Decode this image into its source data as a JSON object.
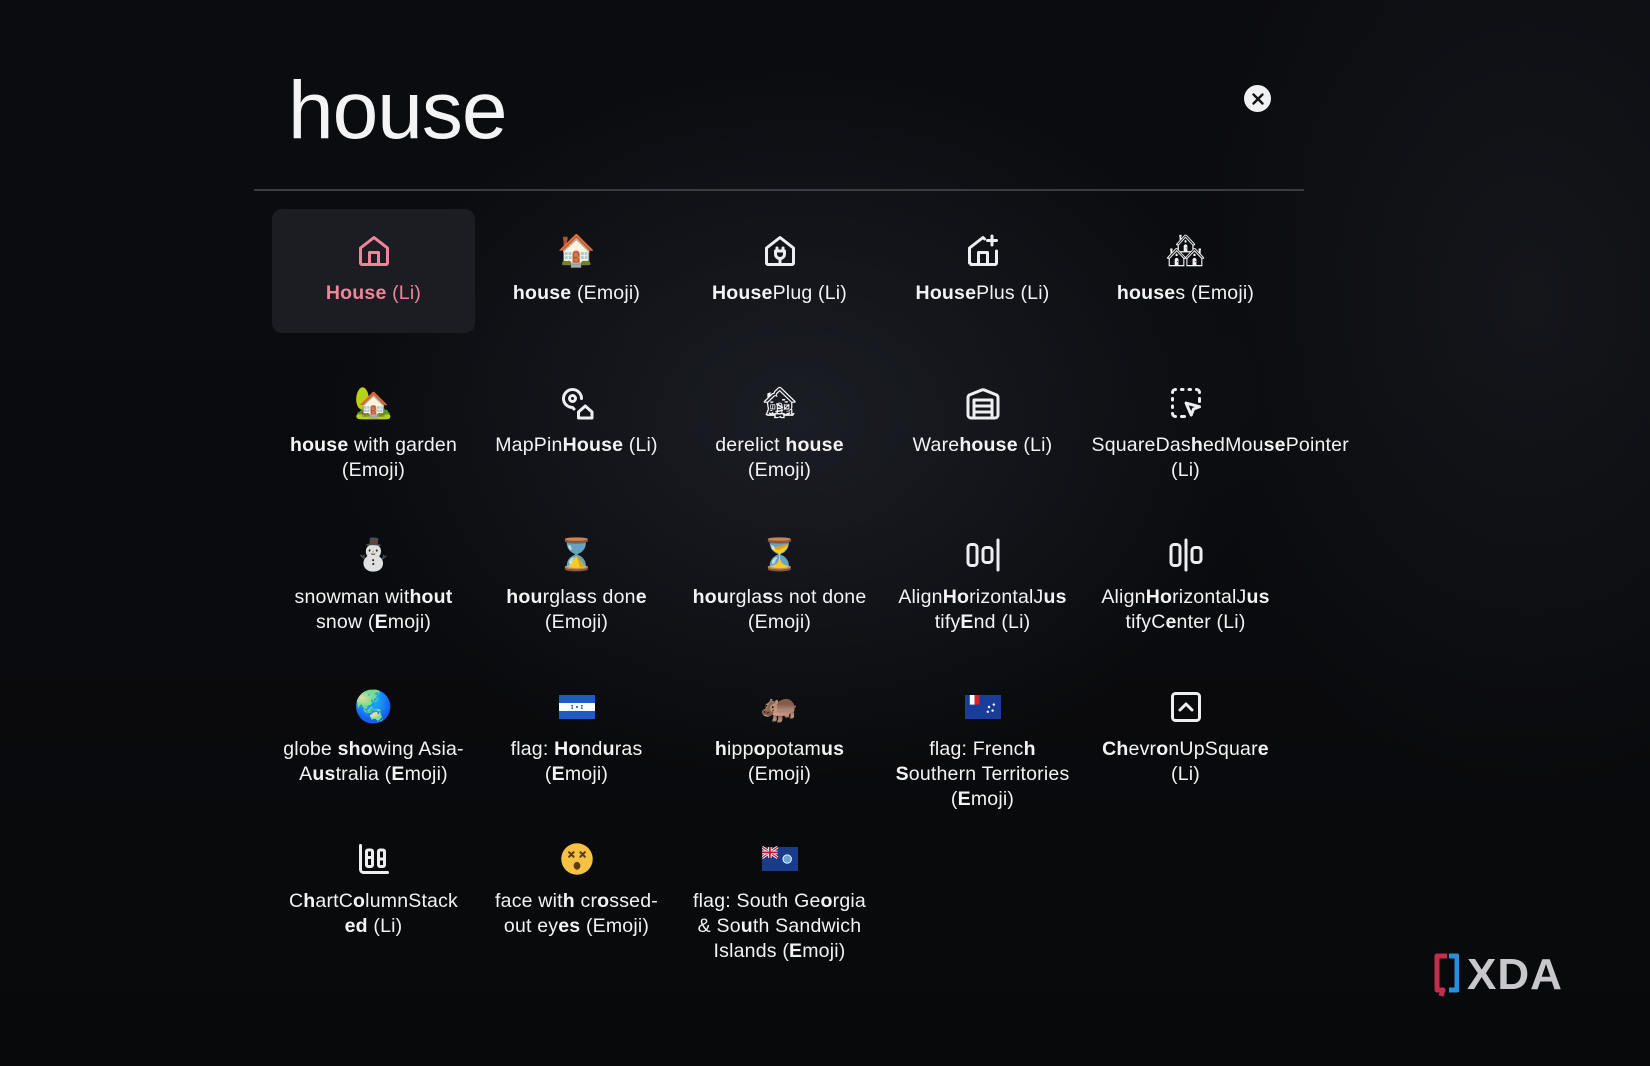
{
  "search": {
    "query": "house"
  },
  "results": [
    {
      "icon": "house-outline-icon",
      "pre": "",
      "bold": "House",
      "post": " (Li)",
      "selected": true
    },
    {
      "icon": "house-emoji",
      "pre": "",
      "bold": "house",
      "post": " (Emoji)"
    },
    {
      "icon": "house-plug-icon",
      "pre": "",
      "bold": "House",
      "post": "Plug (Li)"
    },
    {
      "icon": "house-plus-icon",
      "pre": "",
      "bold": "House",
      "post": "Plus (Li)"
    },
    {
      "icon": "houses-emoji",
      "pre": "",
      "bold": "house",
      "post": "s (Emoji)"
    },
    {
      "icon": "house-with-garden-emoji",
      "pre": "",
      "bold": "house",
      "post": " with garden (Emoji)"
    },
    {
      "icon": "map-pin-house-icon",
      "pre": "MapPin",
      "bold": "House",
      "post": " (Li)"
    },
    {
      "icon": "derelict-house-emoji",
      "pre": "derelict ",
      "bold": "house",
      "post": " (Emoji)"
    },
    {
      "icon": "warehouse-icon",
      "pre": "Ware",
      "bold": "house",
      "post": " (Li)"
    },
    {
      "icon": "square-dashed-mouse-pointer-icon",
      "pre": "SquareDas",
      "bold": "h",
      "post": "edMou",
      "bold2": "se",
      "post2": "Pointer (Li)"
    },
    {
      "icon": "snowman-emoji",
      "pre": "snowman wit",
      "bold": "hout",
      "post": " snow (",
      "bold2": "E",
      "post2": "moji)"
    },
    {
      "icon": "hourglass-done-emoji",
      "pre": "",
      "bold": "hou",
      "post": "rgla",
      "bold2": "s",
      "post2": "s don",
      "bold3": "e",
      "post3": " (Emoji)"
    },
    {
      "icon": "hourglass-not-done-emoji",
      "pre": "",
      "bold": "hou",
      "post": "rgla",
      "bold2": "s",
      "post2": "s not done (Emoji)"
    },
    {
      "icon": "align-horizontal-justify-end-icon",
      "pre": "Align",
      "bold": "Ho",
      "post": "rizontalJ",
      "bold2": "us",
      "post2": " tify",
      "bold3": "E",
      "post3": "nd (Li)"
    },
    {
      "icon": "align-horizontal-justify-center-icon",
      "pre": "Align",
      "bold": "Ho",
      "post": "rizontalJ",
      "bold2": "us",
      "post2": " tifyC",
      "bold3": "e",
      "post3": "nter (Li)"
    },
    {
      "icon": "globe-asia-australia-emoji",
      "pre": "globe ",
      "bold": "sho",
      "post": "wing Asia-A",
      "bold2": "us",
      "post2": "tralia (",
      "bold3": "E",
      "post3": "moji)"
    },
    {
      "icon": "flag-honduras-emoji",
      "pre": "flag: ",
      "bold": "Ho",
      "post": "nd",
      "bold2": "u",
      "post2": "ras (",
      "bold3": "E",
      "post3": "moji)"
    },
    {
      "icon": "hippopotamus-emoji",
      "pre": "",
      "bold": "h",
      "post": "ipp",
      "bold2": "o",
      "post2": "potam",
      "bold3": "us",
      "post3": " (Emoji)"
    },
    {
      "icon": "flag-french-southern-territories-emoji",
      "pre": "flag: Frenc",
      "bold": "h",
      "post": " ",
      "bold2": "S",
      "post2": "outhern Territories (",
      "bold3": "E",
      "post3": "moji)"
    },
    {
      "icon": "chevron-up-square-icon",
      "pre": "",
      "bold": "Ch",
      "post": "evr",
      "bold2": "o",
      "post2": "nUpSquar",
      "bold3": "e",
      "post3": " (Li)"
    },
    {
      "icon": "chart-column-stacked-icon",
      "pre": "C",
      "bold": "h",
      "post": "artC",
      "bold2": "o",
      "post2": "lumnStack ",
      "bold3": "ed",
      "post3": " (Li)"
    },
    {
      "icon": "face-crossed-out-eyes-emoji",
      "pre": "face wit",
      "bold": "h",
      "post": " cr",
      "bold2": "o",
      "post2": "ssed-out ey",
      "bold3": "es",
      "post3": " (Emoji)"
    },
    {
      "icon": "flag-south-georgia-emoji",
      "pre": "flag: South Ge",
      "bold": "o",
      "post": "rgia & So",
      "bold2": "u",
      "post2": "th Sandwich Islands (",
      "bold3": "E",
      "post3": "moji)"
    }
  ],
  "watermark": {
    "text": "XDA"
  }
}
